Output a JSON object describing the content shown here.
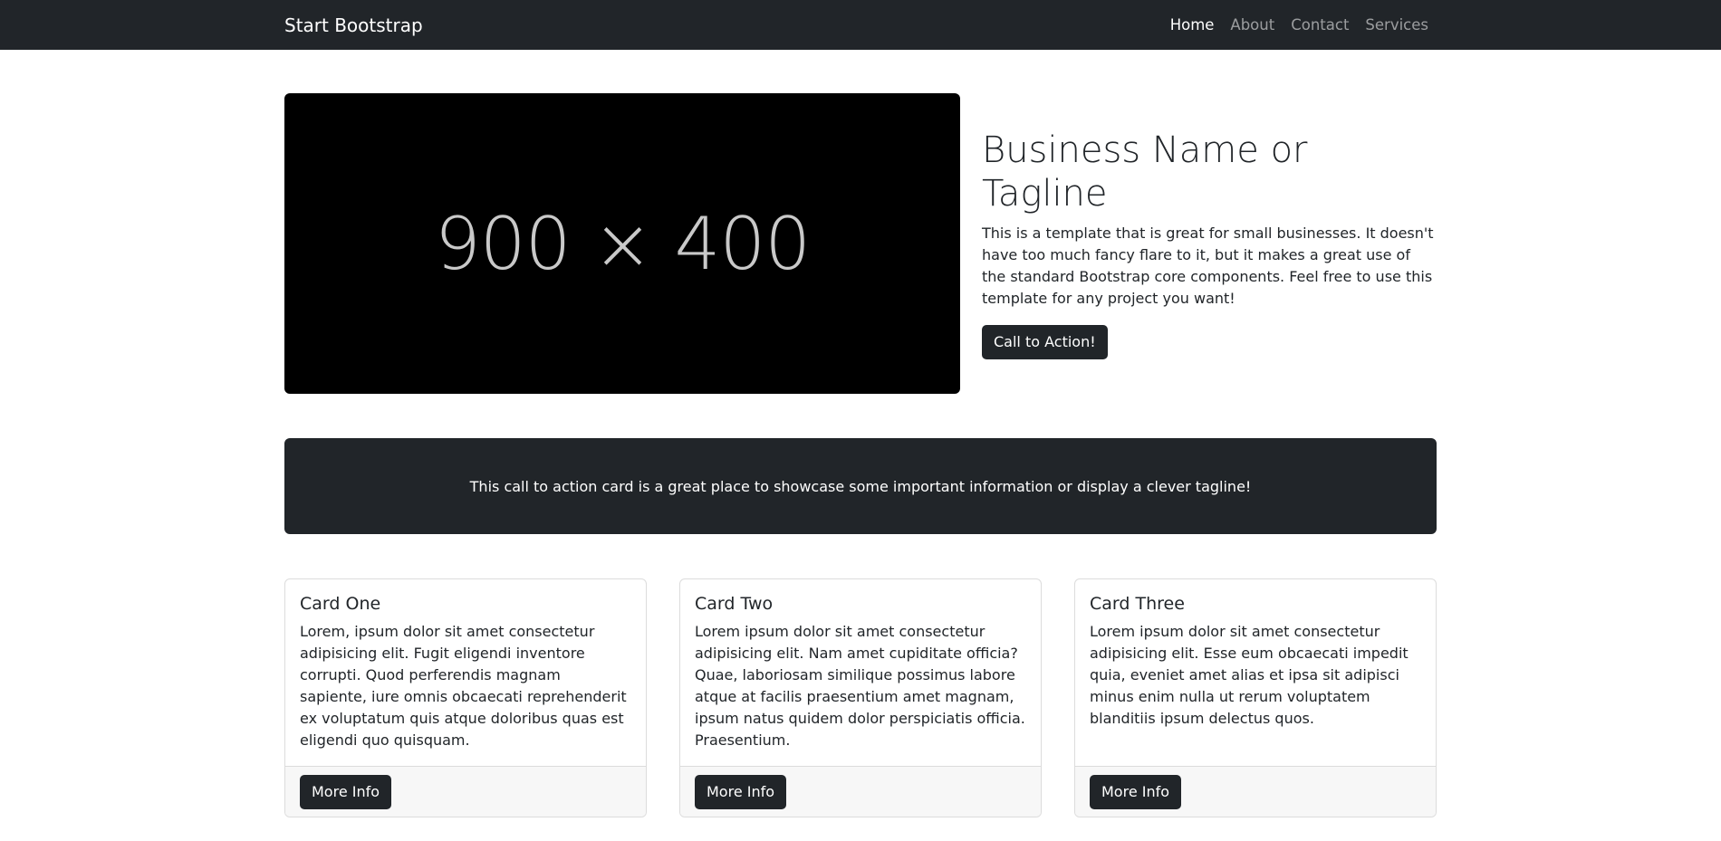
{
  "navbar": {
    "brand": "Start Bootstrap",
    "links": [
      "Home",
      "About",
      "Contact",
      "Services"
    ],
    "active": "Home"
  },
  "hero": {
    "image_placeholder": "900 × 400",
    "title": "Business Name or Tagline",
    "description": "This is a template that is great for small businesses. It doesn't have too much fancy flare to it, but it makes a great use of the standard Bootstrap core components. Feel free to use this template for any project you want!",
    "button_label": "Call to Action!"
  },
  "cta_card": {
    "text": "This call to action card is a great place to showcase some important information or display a clever tagline!"
  },
  "cards": [
    {
      "title": "Card One",
      "text": "Lorem, ipsum dolor sit amet consectetur adipisicing elit. Fugit eligendi inventore corrupti. Quod perferendis magnam sapiente, iure omnis obcaecati reprehenderit ex voluptatum quis atque doloribus quas est eligendi quo quisquam.",
      "button_label": "More Info"
    },
    {
      "title": "Card Two",
      "text": "Lorem ipsum dolor sit amet consectetur adipisicing elit. Nam amet cupiditate officia? Quae, laboriosam similique possimus labore atque at facilis praesentium amet magnam, ipsum natus quidem dolor perspiciatis officia. Praesentium.",
      "button_label": "More Info"
    },
    {
      "title": "Card Three",
      "text": "Lorem ipsum dolor sit amet consectetur adipisicing elit. Esse eum obcaecati impedit quia, eveniet amet alias et ipsa sit adipisci minus enim nulla ut rerum voluptatem blanditiis ipsum delectus quos.",
      "button_label": "More Info"
    }
  ],
  "colors": {
    "navbar_bg": "#212529",
    "button_bg": "#212529",
    "placeholder_bg": "#000000"
  }
}
